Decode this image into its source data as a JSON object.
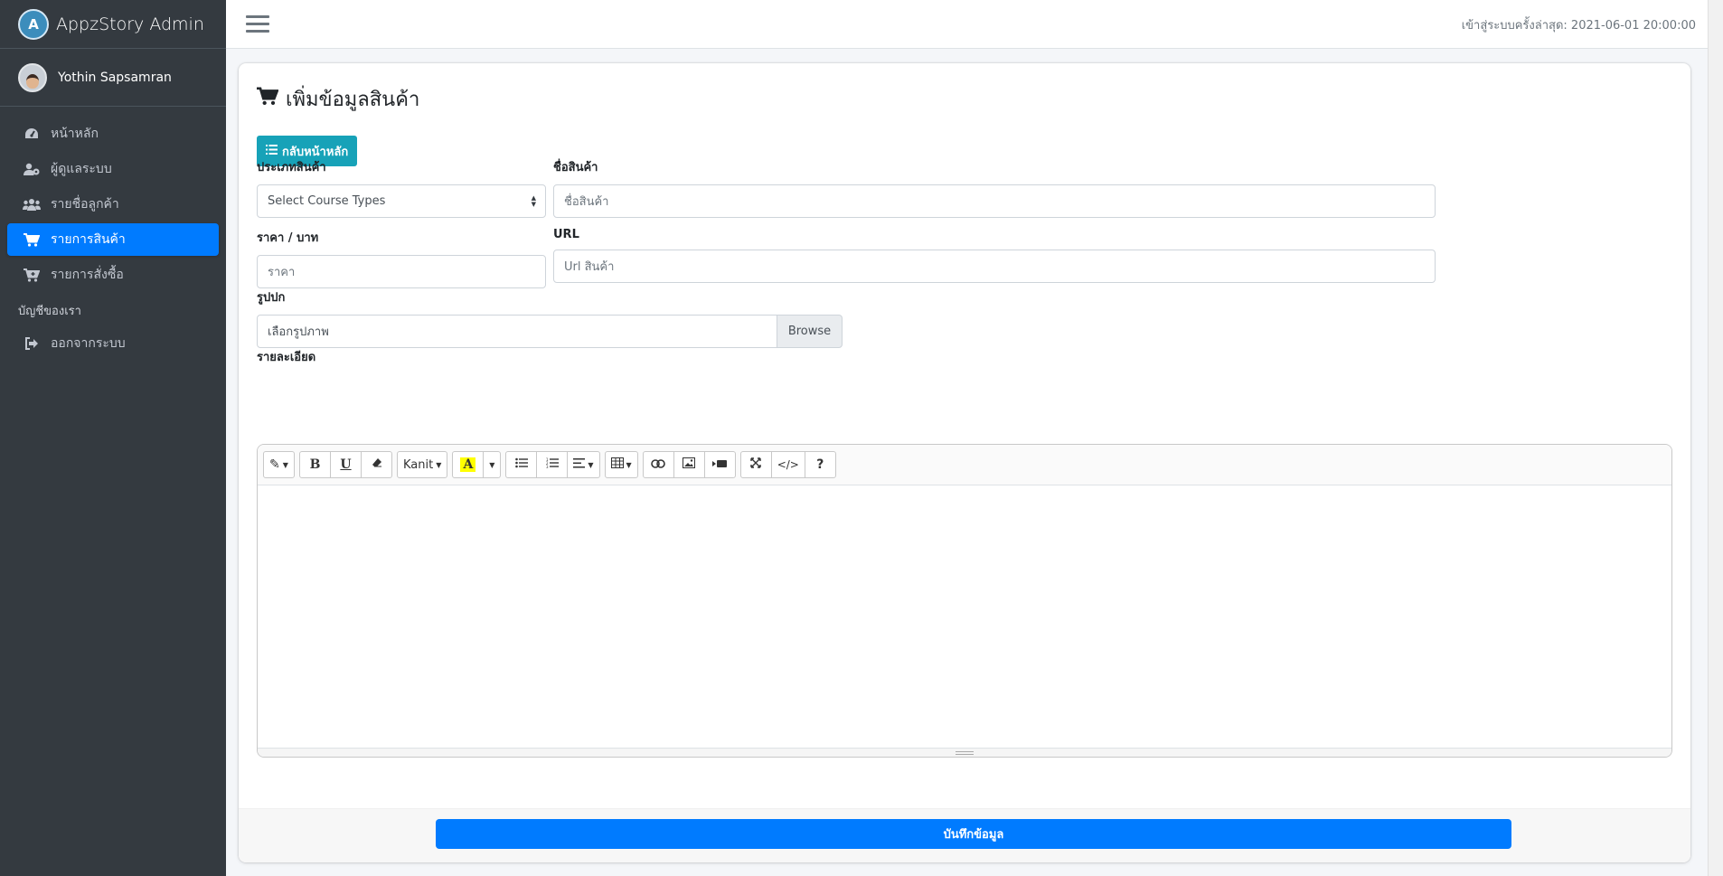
{
  "brand": {
    "logo_text": "A",
    "name": "AppzStory Admin"
  },
  "user": {
    "name": "Yothin Sapsamran"
  },
  "sidebar": {
    "items": [
      {
        "label": "หน้าหลัก",
        "icon": "tachometer-icon",
        "glyph": "◔"
      },
      {
        "label": "ผู้ดูแลระบบ",
        "icon": "user-cog-icon",
        "glyph": "👤"
      },
      {
        "label": "รายชื่อลูกค้า",
        "icon": "users-icon",
        "glyph": "👥"
      },
      {
        "label": "รายการสินค้า",
        "icon": "shopping-cart-icon",
        "glyph": "🛒",
        "active": true
      },
      {
        "label": "รายการสั่งซื้อ",
        "icon": "cart-plus-icon",
        "glyph": "🛒"
      }
    ],
    "section_header": "บัญชีของเรา",
    "logout": {
      "label": "ออกจากระบบ",
      "icon": "sign-out-icon",
      "glyph": "➜"
    }
  },
  "topbar": {
    "last_login": "เข้าสู่ระบบครั้งล่าสุด: 2021-06-01 20:00:00"
  },
  "page": {
    "title": "เพิ่มข้อมูลสินค้า",
    "back_button": "กลับหน้าหลัก"
  },
  "form": {
    "type_label": "ประเภทสินค้า",
    "type_value": "Select Course Types",
    "name_label": "ชื่อสินค้า",
    "name_placeholder": "ชื่อสินค้า",
    "price_label": "ราคา / บาท",
    "price_placeholder": "ราคา",
    "url_label": "URL",
    "url_placeholder": "Url สินค้า",
    "image_label": "รูปปก",
    "image_placeholder": "เลือกรูปภาพ",
    "browse_label": "Browse",
    "detail_label": "รายละเอียด"
  },
  "editor": {
    "font_name": "Kanit",
    "bold": "B",
    "underline": "U",
    "highlight": "A",
    "help": "?",
    "code": "</>"
  },
  "footer": {
    "save_button": "บันทึกข้อมูล"
  },
  "colors": {
    "sidebar_bg": "#343a40",
    "primary": "#007bff",
    "info": "#17a2b8"
  }
}
